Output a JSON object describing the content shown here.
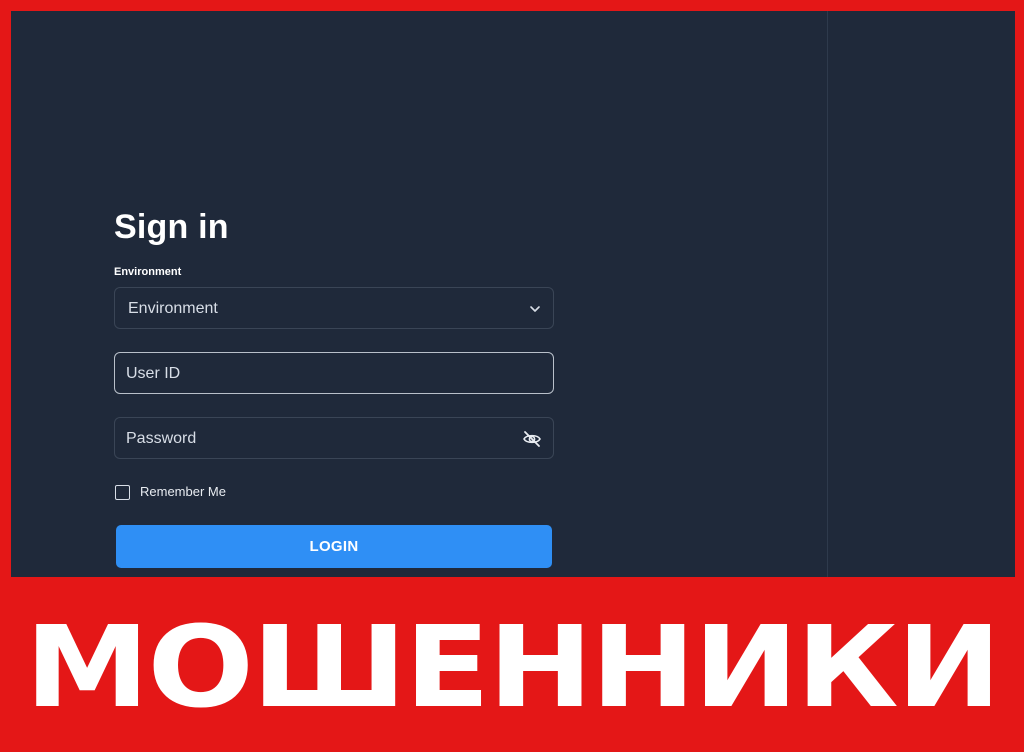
{
  "login": {
    "title": "Sign in",
    "environment_label": "Environment",
    "environment_select_value": "Environment",
    "user_id_placeholder": "User ID",
    "password_placeholder": "Password",
    "remember_label": "Remember Me",
    "login_button": "LOGIN"
  },
  "banner": {
    "text": "МОШЕННИКИ"
  },
  "icons": {
    "select": "chevron-down-icon",
    "password": "eye-off-icon"
  },
  "colors": {
    "frame_red": "#e41717",
    "page_bg": "#1f293a",
    "primary_button": "#2f8ff5"
  }
}
